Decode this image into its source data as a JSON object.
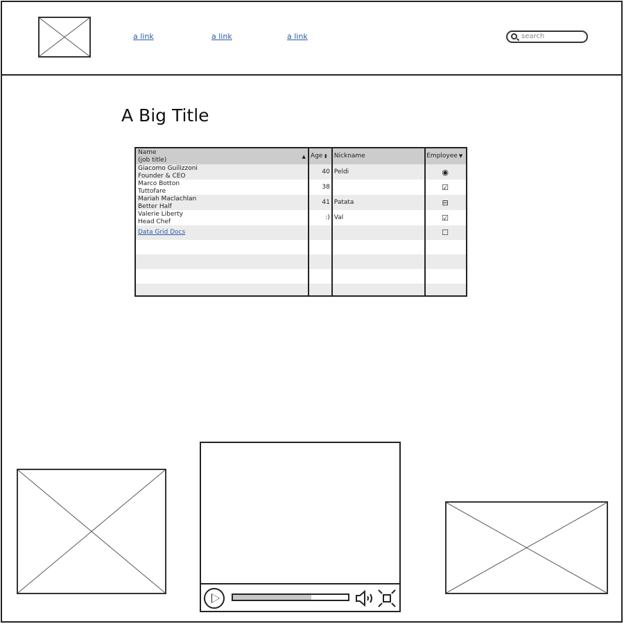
{
  "nav": {
    "links": [
      "a link",
      "a link",
      "a link"
    ],
    "search_placeholder": "search"
  },
  "title": "A Big Title",
  "grid": {
    "headers": {
      "name": "Name",
      "name_sub": "(job title)",
      "age": "Age",
      "nickname": "Nickname",
      "employee": "Employee"
    },
    "rows": [
      {
        "name": "Giacomo Guilizzoni",
        "job": "Founder & CEO",
        "age": "40",
        "nickname": "Peldi",
        "employee": "radio-selected"
      },
      {
        "name": "Marco Botton",
        "job": "Tuttofare",
        "age": "38",
        "nickname": "",
        "employee": "checked"
      },
      {
        "name": "Mariah Maclachlan",
        "job": "Better Half",
        "age": "41",
        "nickname": "Patata",
        "employee": "indeterminate"
      },
      {
        "name": "Valerie Liberty",
        "job": "Head Chef",
        "age": ":)",
        "nickname": "Val",
        "employee": "checked"
      }
    ],
    "link_row": {
      "label": "Data Grid Docs",
      "employee": "unchecked"
    }
  },
  "video": {
    "progress_percent": 68
  }
}
